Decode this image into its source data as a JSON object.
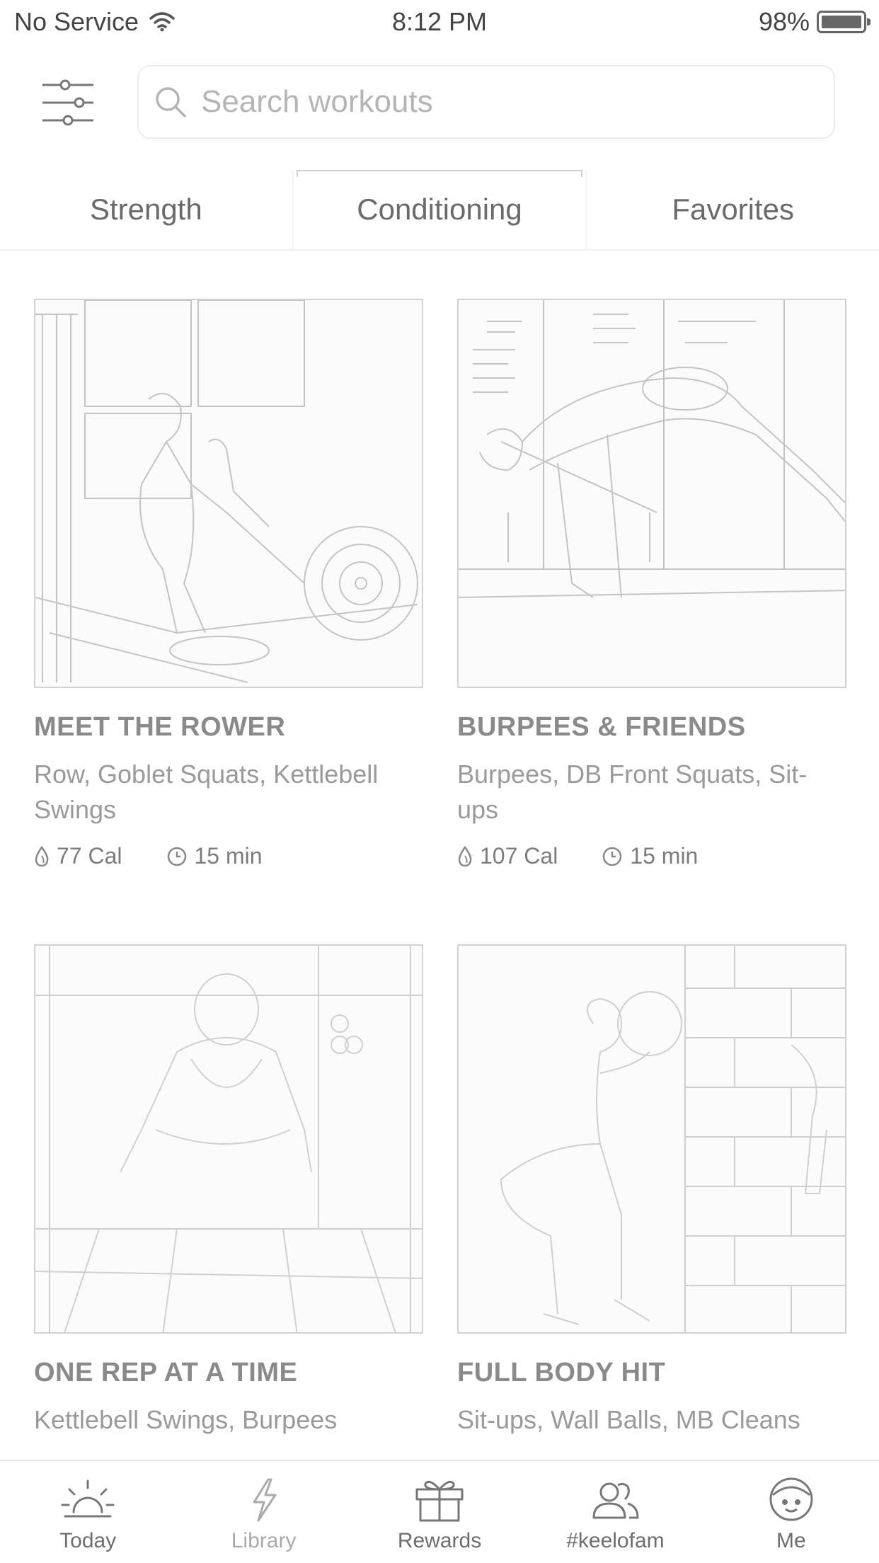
{
  "status_bar": {
    "carrier": "No Service",
    "time": "8:12 PM",
    "battery": "98%"
  },
  "search": {
    "placeholder": "Search workouts",
    "value": ""
  },
  "tabs": [
    {
      "label": "Strength",
      "active": false
    },
    {
      "label": "Conditioning",
      "active": true
    },
    {
      "label": "Favorites",
      "active": false
    }
  ],
  "workouts": [
    {
      "title": "MEET THE ROWER",
      "exercises": "Row, Goblet Squats, Kettlebell Swings",
      "calories": "77 Cal",
      "duration": "15 min"
    },
    {
      "title": "BURPEES & FRIENDS",
      "exercises": "Burpees, DB Front Squats, Sit-ups",
      "calories": "107 Cal",
      "duration": "15 min"
    },
    {
      "title": "ONE REP AT A TIME",
      "exercises": "Kettlebell Swings, Burpees"
    },
    {
      "title": "FULL BODY HIT",
      "exercises": "Sit-ups, Wall Balls, MB Cleans"
    }
  ],
  "nav": [
    {
      "label": "Today",
      "icon": "sun-icon"
    },
    {
      "label": "Library",
      "icon": "lightning-icon"
    },
    {
      "label": "Rewards",
      "icon": "gift-icon"
    },
    {
      "label": "#keelofam",
      "icon": "people-icon"
    },
    {
      "label": "Me",
      "icon": "face-icon"
    }
  ]
}
